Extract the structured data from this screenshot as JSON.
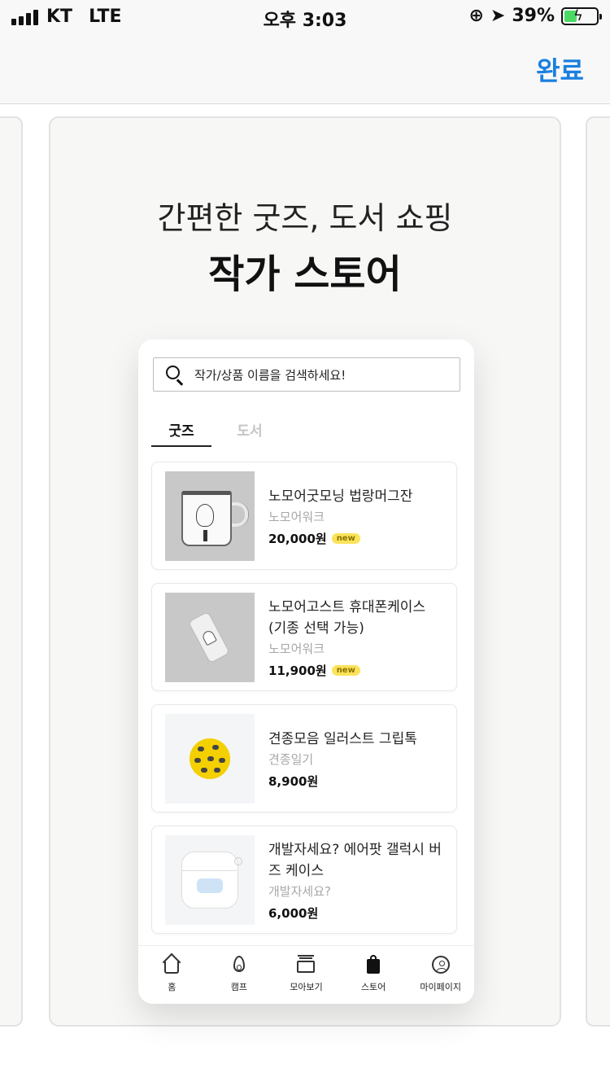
{
  "status_bar": {
    "carrier": "KT",
    "network": "LTE",
    "time": "오후 3:03",
    "battery_percent": "39%",
    "battery_level": 0.39,
    "charging": true
  },
  "header": {
    "done_label": "완료"
  },
  "card": {
    "subtitle": "간편한 굿즈, 도서 쇼핑",
    "title": "작가 스토어"
  },
  "phone": {
    "search_placeholder": "작가/상품 이름을 검색하세요!",
    "tabs": [
      {
        "label": "굿즈",
        "active": true
      },
      {
        "label": "도서",
        "active": false
      }
    ],
    "items": [
      {
        "name": "노모어굿모닝 법랑머그잔",
        "seller": "노모어워크",
        "price": "20,000원",
        "badge": "new"
      },
      {
        "name": "노모어고스트 휴대폰케이스 (기종 선택 가능)",
        "seller": "노모어워크",
        "price": "11,900원",
        "badge": "new"
      },
      {
        "name": "견종모음 일러스트 그립톡",
        "seller": "견종일기",
        "price": "8,900원",
        "badge": ""
      },
      {
        "name": "개발자세요? 에어팟 갤럭시 버즈 케이스",
        "seller": "개발자세요?",
        "price": "6,000원",
        "badge": ""
      }
    ],
    "bottom_nav": [
      {
        "label": "홈",
        "icon": "home-icon"
      },
      {
        "label": "캠프",
        "icon": "fire-icon"
      },
      {
        "label": "모아보기",
        "icon": "layers-icon"
      },
      {
        "label": "스토어",
        "icon": "shopping-bag-icon"
      },
      {
        "label": "마이페이지",
        "icon": "user-icon"
      }
    ]
  },
  "colors": {
    "accent": "#1a7fe0",
    "badge": "#fbe35a",
    "battery": "#4cd964"
  }
}
